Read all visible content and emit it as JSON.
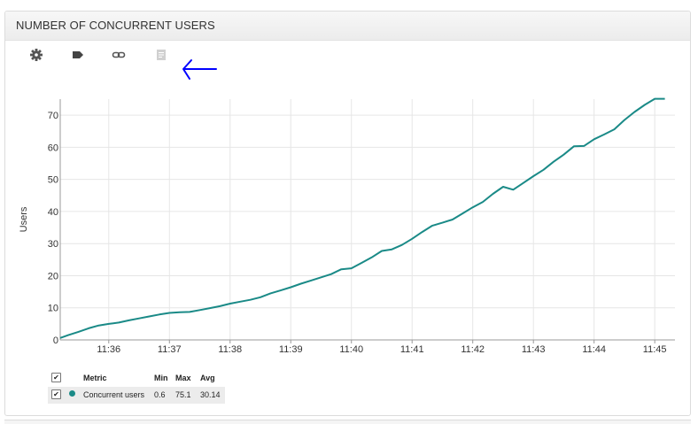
{
  "panel": {
    "title": "NUMBER OF CONCURRENT USERS"
  },
  "toolbar": {
    "items": [
      {
        "name": "settings",
        "icon": "gear-icon"
      },
      {
        "name": "tag",
        "icon": "tag-icon"
      },
      {
        "name": "link",
        "icon": "link-icon"
      },
      {
        "name": "document",
        "icon": "document-icon",
        "disabled": true
      }
    ]
  },
  "annotation": {
    "icon": "left-arrow-icon",
    "color": "#0000ff"
  },
  "colors": {
    "series": "#1a8a87",
    "grid": "#e6e6e6",
    "axis": "#999999"
  },
  "chart_data": {
    "type": "line",
    "ylabel": "Users",
    "xlabel": "",
    "ylim": [
      0,
      75
    ],
    "yticks": [
      0,
      10,
      20,
      30,
      40,
      50,
      60,
      70
    ],
    "xticks": [
      "11:36",
      "11:37",
      "11:38",
      "11:39",
      "11:40",
      "11:41",
      "11:42",
      "11:43",
      "11:44",
      "11:45"
    ],
    "xlim": [
      "11:35:12",
      "11:45:20"
    ],
    "grid": true,
    "series": [
      {
        "name": "Concurrent users",
        "color": "#1a8a87",
        "x": [
          "11:35:12",
          "11:35:20",
          "11:35:30",
          "11:35:40",
          "11:35:50",
          "11:36:00",
          "11:36:10",
          "11:36:20",
          "11:36:30",
          "11:36:40",
          "11:36:50",
          "11:37:00",
          "11:37:10",
          "11:37:20",
          "11:37:30",
          "11:37:40",
          "11:37:50",
          "11:38:00",
          "11:38:10",
          "11:38:20",
          "11:38:30",
          "11:38:40",
          "11:38:50",
          "11:39:00",
          "11:39:10",
          "11:39:20",
          "11:39:30",
          "11:39:40",
          "11:39:50",
          "11:40:00",
          "11:40:10",
          "11:40:20",
          "11:40:30",
          "11:40:40",
          "11:40:50",
          "11:41:00",
          "11:41:10",
          "11:41:20",
          "11:41:30",
          "11:41:40",
          "11:41:50",
          "11:42:00",
          "11:42:10",
          "11:42:20",
          "11:42:30",
          "11:42:40",
          "11:42:50",
          "11:43:00",
          "11:43:10",
          "11:43:20",
          "11:43:30",
          "11:43:40",
          "11:43:50",
          "11:44:00",
          "11:44:10",
          "11:44:20",
          "11:44:30",
          "11:44:40",
          "11:44:50",
          "11:45:00",
          "11:45:10"
        ],
        "values": [
          0.6,
          1.5,
          2.5,
          3.6,
          4.5,
          5.0,
          5.4,
          6.1,
          6.7,
          7.3,
          7.9,
          8.4,
          8.6,
          8.7,
          9.3,
          9.9,
          10.5,
          11.3,
          11.9,
          12.5,
          13.3,
          14.5,
          15.4,
          16.4,
          17.5,
          18.5,
          19.5,
          20.5,
          22.0,
          22.3,
          24.0,
          25.7,
          27.7,
          28.2,
          29.6,
          31.5,
          33.6,
          35.6,
          36.5,
          37.5,
          39.4,
          41.3,
          43.0,
          45.5,
          47.7,
          46.8,
          48.9,
          51.0,
          53.0,
          55.5,
          57.7,
          60.3,
          60.4,
          62.5,
          64.0,
          65.6,
          68.5,
          71.0,
          73.2,
          75.1,
          75.1
        ]
      }
    ]
  },
  "legend": {
    "headers": {
      "metric": "Metric",
      "min": "Min",
      "max": "Max",
      "avg": "Avg"
    },
    "rows": [
      {
        "metric": "Concurrent users",
        "min": "0.6",
        "max": "75.1",
        "avg": "30.14",
        "checked": true
      }
    ],
    "header_checked": true
  }
}
